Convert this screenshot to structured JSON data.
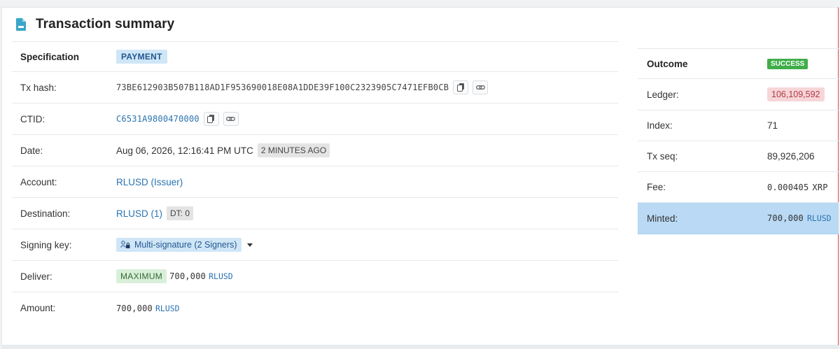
{
  "card": {
    "title": "Transaction summary",
    "icon": "document-icon"
  },
  "spec": {
    "header_label": "Specification",
    "type_badge": "PAYMENT",
    "rows": {
      "tx_hash": {
        "label": "Tx hash:",
        "value": "73BE612903B507B118AD1F953690018E08A1DDE39F100C2323905C7471EFB0CB"
      },
      "ctid": {
        "label": "CTID:",
        "value": "C6531A9800470000"
      },
      "date": {
        "label": "Date:",
        "value": "Aug 06, 2026, 12:16:41 PM UTC",
        "ago": "2 MINUTES AGO"
      },
      "account": {
        "label": "Account:",
        "value": "RLUSD (Issuer)"
      },
      "destination": {
        "label": "Destination:",
        "value": "RLUSD (1)",
        "dt": "DT: 0"
      },
      "signing_key": {
        "label": "Signing key:",
        "value": "Multi-signature (2 Signers)"
      },
      "deliver": {
        "label": "Deliver:",
        "tag": "MAXIMUM",
        "amount": "700,000",
        "currency": "RLUSD"
      },
      "amount": {
        "label": "Amount:",
        "amount": "700,000",
        "currency": "RLUSD"
      }
    }
  },
  "outcome": {
    "header_label": "Outcome",
    "status": "SUCCESS",
    "ledger": {
      "label": "Ledger:",
      "value": "106,109,592"
    },
    "index": {
      "label": "Index:",
      "value": "71"
    },
    "tx_seq": {
      "label": "Tx seq:",
      "value": "89,926,206"
    },
    "fee": {
      "label": "Fee:",
      "value": "0.000405",
      "currency": "XRP"
    },
    "minted": {
      "label": "Minted:",
      "value": "700,000",
      "currency": "RLUSD"
    }
  },
  "colors": {
    "link": "#2a73b0",
    "success": "#3fae49",
    "minted_bg": "#b9d9f5",
    "ledger_bg": "#f6d6d8"
  }
}
